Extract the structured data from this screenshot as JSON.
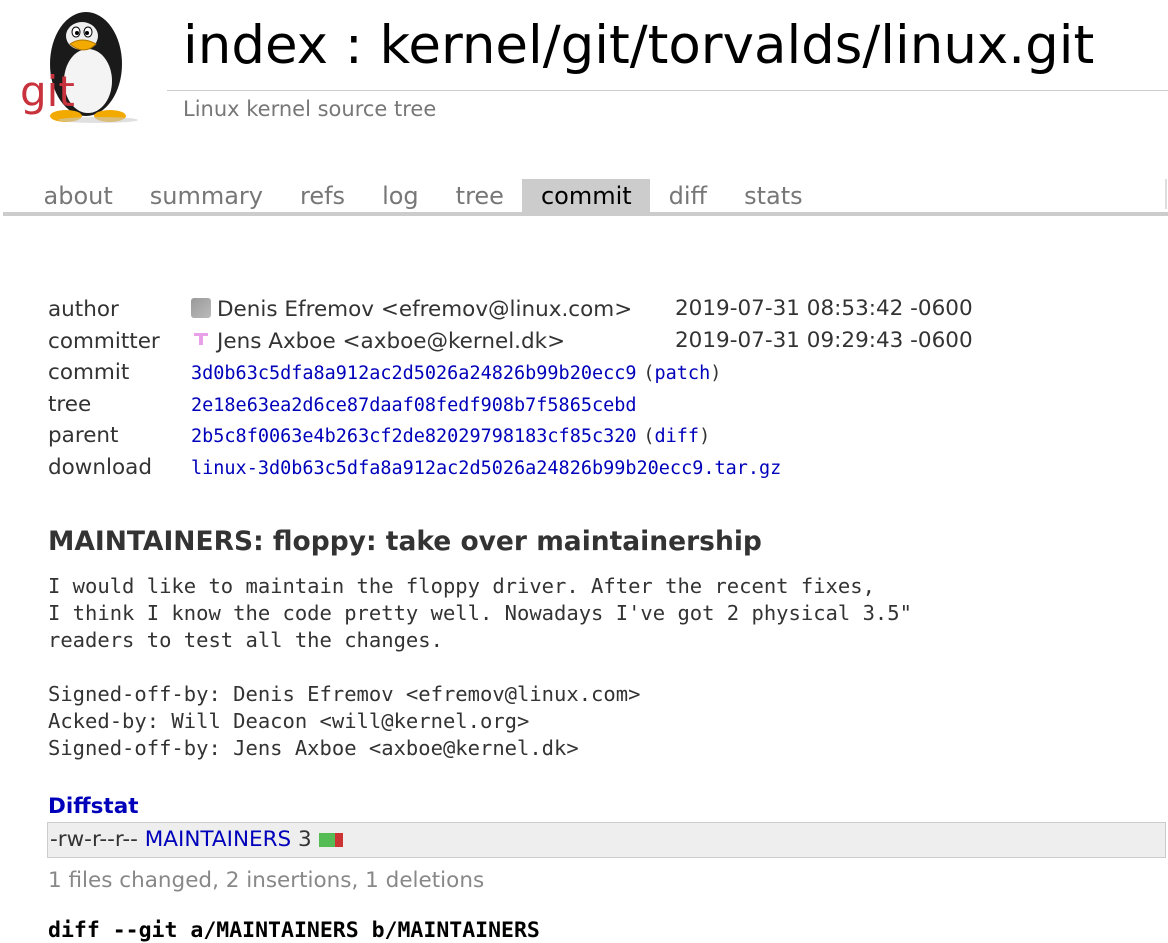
{
  "logo": {
    "icon": "git-tux-logo",
    "text": "git",
    "text_color": "#c8323c"
  },
  "header": {
    "title": "index : kernel/git/torvalds/linux.git",
    "subtitle": "Linux kernel source tree"
  },
  "tabs": [
    {
      "label": "about"
    },
    {
      "label": "summary"
    },
    {
      "label": "refs"
    },
    {
      "label": "log"
    },
    {
      "label": "tree"
    },
    {
      "label": "commit",
      "active": true
    },
    {
      "label": "diff"
    },
    {
      "label": "stats"
    }
  ],
  "commit_info": {
    "author": {
      "label": "author",
      "name": "Denis Efremov <efremov@linux.com>",
      "date": "2019-07-31 08:53:42 -0600",
      "avatar_icon": "author-avatar-icon"
    },
    "committer": {
      "label": "committer",
      "name": "Jens Axboe <axboe@kernel.dk>",
      "date": "2019-07-31 09:29:43 -0600",
      "avatar_icon": "committer-avatar-icon"
    },
    "commit": {
      "label": "commit",
      "hash": "3d0b63c5dfa8a912ac2d5026a24826b99b20ecc9",
      "link_open": "(",
      "link_label": "patch",
      "link_close": ")"
    },
    "tree": {
      "label": "tree",
      "hash": "2e18e63ea2d6ce87daaf08fedf908b7f5865cebd"
    },
    "parent": {
      "label": "parent",
      "hash": "2b5c8f0063e4b263cf2de82029798183cf85c320",
      "link_open": "(",
      "link_label": "diff",
      "link_close": ")"
    },
    "download": {
      "label": "download",
      "file": "linux-3d0b63c5dfa8a912ac2d5026a24826b99b20ecc9.tar.gz"
    }
  },
  "subject": "MAINTAINERS: floppy: take over maintainership",
  "message": "I would like to maintain the floppy driver. After the recent fixes,\nI think I know the code pretty well. Nowadays I've got 2 physical 3.5\"\nreaders to test all the changes.\n\nSigned-off-by: Denis Efremov <efremov@linux.com>\nAcked-by: Will Deacon <will@kernel.org>\nSigned-off-by: Jens Axboe <axboe@kernel.dk>",
  "diffstat": {
    "heading": "Diffstat",
    "files": [
      {
        "mode": "-rw-r--r--",
        "name": "MAINTAINERS",
        "changes": "3",
        "insertions": 2,
        "deletions": 1
      }
    ],
    "summary": "1 files changed, 2 insertions, 1 deletions"
  },
  "diff_header": "diff --git a/MAINTAINERS b/MAINTAINERS",
  "colors": {
    "link": "#0000bb",
    "insert": "#55bb55",
    "delete": "#cc3333",
    "tab_active_bg": "#cccccc"
  }
}
